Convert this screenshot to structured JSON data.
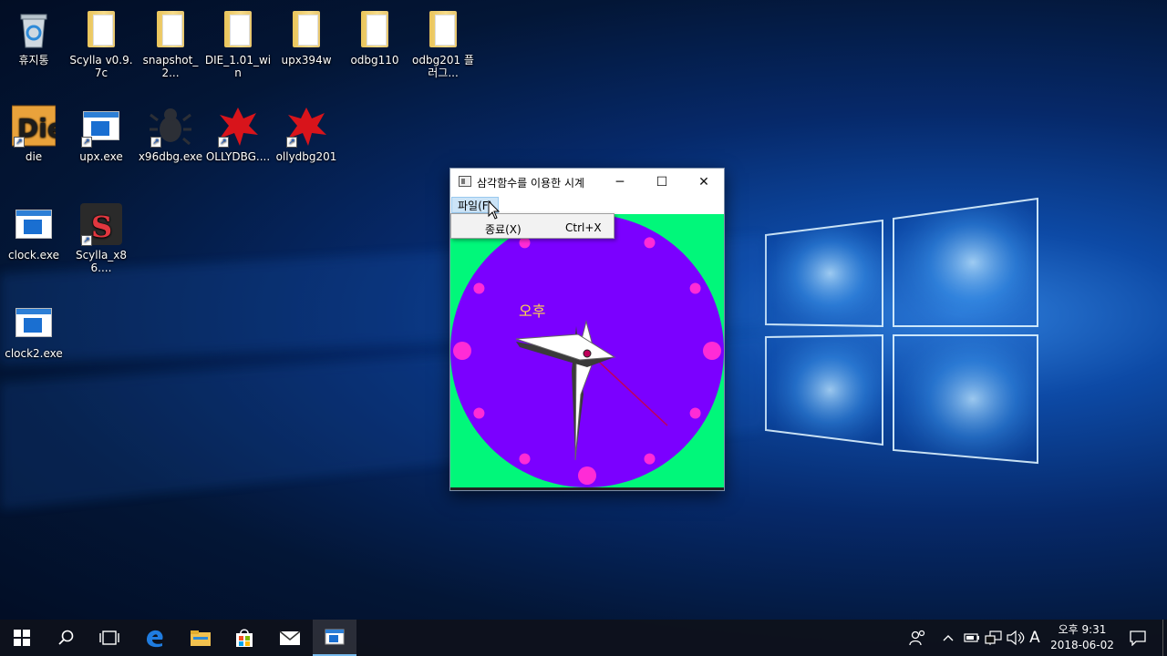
{
  "desktop": {
    "icons": [
      {
        "label": "휴지통",
        "type": "recycle-bin"
      },
      {
        "label": "Scylla v0.9.7c",
        "type": "folder"
      },
      {
        "label": "snapshot_2...",
        "type": "folder"
      },
      {
        "label": "DIE_1.01_win",
        "type": "folder"
      },
      {
        "label": "upx394w",
        "type": "folder"
      },
      {
        "label": "odbg110",
        "type": "folder"
      },
      {
        "label": "odbg201 플러그...",
        "type": "folder"
      },
      {
        "label": "die",
        "type": "die-app"
      },
      {
        "label": "upx.exe",
        "type": "exe-shortcut"
      },
      {
        "label": "x96dbg.exe",
        "type": "bug-shortcut"
      },
      {
        "label": "OLLYDBG....",
        "type": "olly-shortcut"
      },
      {
        "label": "ollydbg201",
        "type": "olly-shortcut"
      },
      {
        "label": "clock.exe",
        "type": "exe"
      },
      {
        "label": "Scylla_x86....",
        "type": "scylla-shortcut"
      },
      {
        "label": "clock2.exe",
        "type": "exe"
      }
    ]
  },
  "window": {
    "title": "삼각함수를 이용한 시계",
    "minimize": "─",
    "maximize": "☐",
    "close": "✕",
    "menu_file": "파일(F)",
    "clock": {
      "ampm": "오후",
      "background_color": "#01f77a",
      "face_color": "#7b00ff",
      "dot_color": "#ff2bd6"
    }
  },
  "dropdown": {
    "exit_label": "종료(X)",
    "exit_shortcut": "Ctrl+X"
  },
  "taskbar": {
    "tray_ime": "A",
    "time": "오후 9:31",
    "date": "2018-06-02"
  },
  "colors": {
    "accent": "#76b9ed",
    "menu_highlight": "#cce4f7"
  }
}
